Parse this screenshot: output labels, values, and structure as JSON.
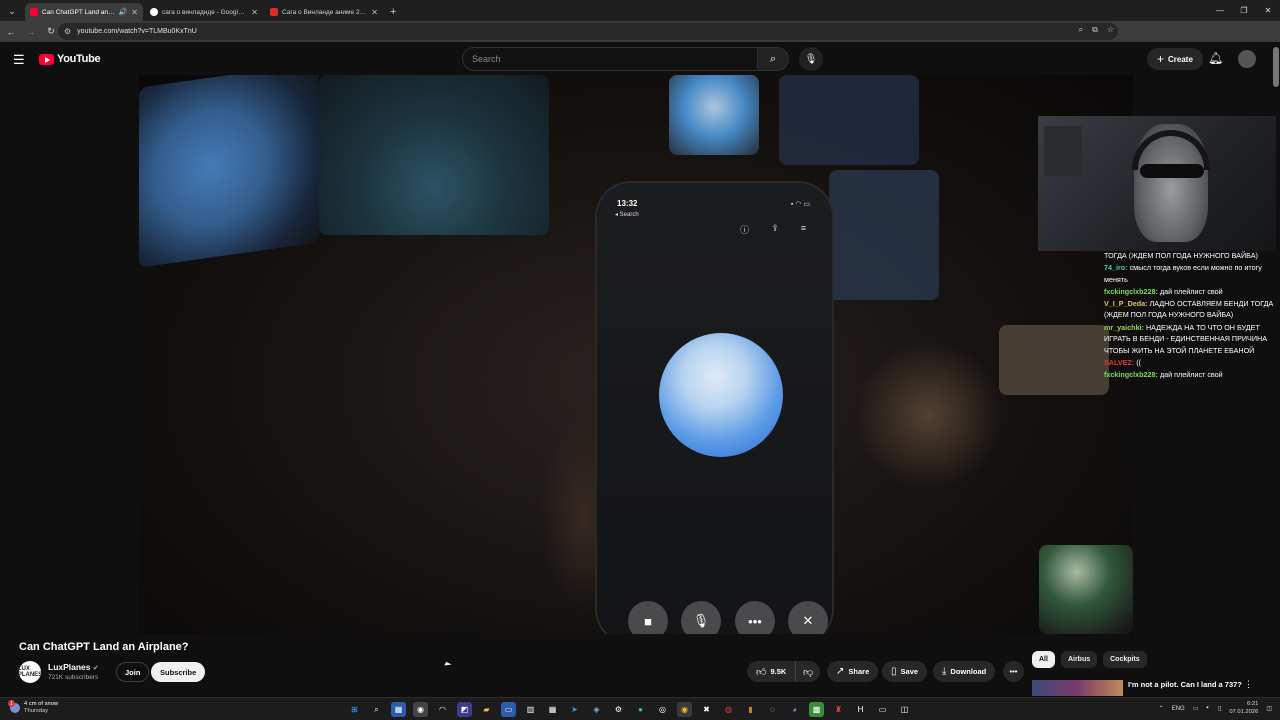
{
  "browser": {
    "tabs": [
      {
        "title": "Can ChatGPT Land an Airpla...",
        "active": true,
        "favicon_color": "#ff0033"
      },
      {
        "title": "сага о винладнде - Google Search",
        "active": false,
        "favicon_color": "#ffffff"
      },
      {
        "title": "Сага о Винланде аниме 2019...",
        "active": false,
        "favicon_color": "#d93025"
      }
    ],
    "new_tab": "+",
    "window_controls": [
      "—",
      "❐",
      "✕"
    ],
    "url": "youtube.com/watch?v=TLMBu0KxTnU"
  },
  "youtube": {
    "logo_text": "YouTube",
    "search_placeholder": "Search",
    "create_label": "Create",
    "accent": "#ff0033"
  },
  "video": {
    "phone_time": "13:32",
    "phone_back": "◂ Search"
  },
  "chat": [
    {
      "user": "",
      "text": "ТОГДА (ЖДЕМ ПОЛ ГОДА НУЖНОГО ВАЙБА)",
      "color": "#ffffff"
    },
    {
      "user": "74_iro:",
      "text": "смысл тогда вуков если можно по итогу менять",
      "color": "#4ec9b0"
    },
    {
      "user": "fxckingclxb228:",
      "text": "дай плейлист свой",
      "color": "#7ddc5a"
    },
    {
      "user": "V_I_P_Deda:",
      "text": "ЛАДНО ОСТАВЛЯЕМ БЕНДИ ТОГДА (ЖДЕМ ПОЛ ГОДА НУЖНОГО ВАЙБА)",
      "color": "#e0c060"
    },
    {
      "user": "mr_yaichki:",
      "text": "НАДЕЖДА НА ТО ЧТО ОН БУДЕТ ИГРАТЬ В БЕНДИ - ЕДИНСТВЕННАЯ ПРИЧИНА ЧТОБЫ ЖИТЬ НА ЭТОЙ ПЛАНЕТЕ ЕБАНОЙ",
      "color": "#9ad35c"
    },
    {
      "user": "SALVEZ:",
      "text": "((",
      "color": "#e03a3a"
    },
    {
      "user": "fxckingclxb228:",
      "text": "дай плейлист свой",
      "color": "#7ddc5a"
    }
  ],
  "meta": {
    "title": "Can ChatGPT Land an Airplane?",
    "channel": "LuxPlanes",
    "channel_avatar_text": "LUX PLANES",
    "subscribers": "721K subscribers",
    "join_label": "Join",
    "subscribe_label": "Subscribe",
    "likes": "9.5K",
    "share_label": "Share",
    "save_label": "Save",
    "download_label": "Download"
  },
  "chips": [
    "All",
    "Airbus",
    "Cockpits"
  ],
  "recommendation": {
    "title": "I'm not a pilot. Can I land a 737?"
  },
  "taskbar": {
    "weather_line1": "4 cm of snow",
    "weather_line2": "Thursday",
    "lang": "ENG",
    "time": "6:21",
    "date": "07.01.2026"
  }
}
